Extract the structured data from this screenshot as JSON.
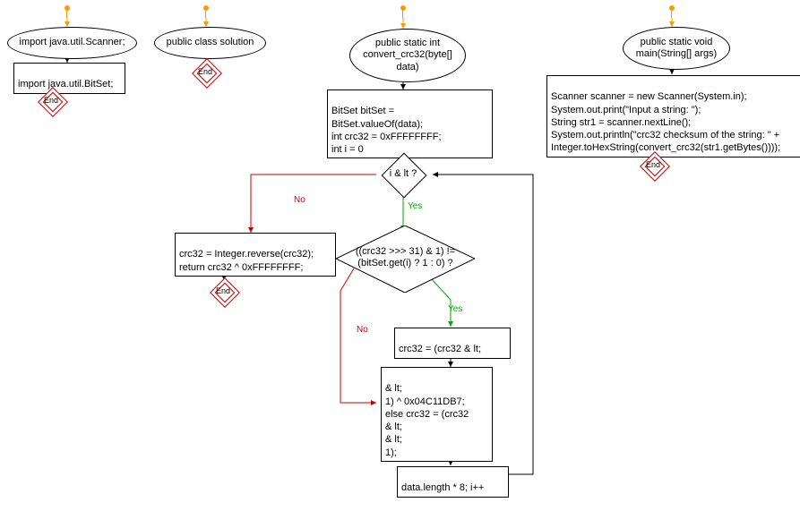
{
  "start_arrow_color": "#f90",
  "nodes": {
    "import1": {
      "text": "import java.util.Scanner;"
    },
    "import2": {
      "text": "import java.util.BitSet;"
    },
    "class_decl": {
      "text": "public class solution"
    },
    "method_convert": {
      "text": "public static int\nconvert_crc32(byte[]\ndata)"
    },
    "init_block": {
      "text": "BitSet bitSet = BitSet.valueOf(data);\nint crc32 = 0xFFFFFFFF;\nint i = 0"
    },
    "cond_i": {
      "text": "i & lt ?"
    },
    "cond_bit": {
      "text": "((crc32 >>> 31) & 1) !=\n(bitSet.get(i) ? 1 : 0) ?"
    },
    "no_branch": {
      "text": "crc32 = Integer.reverse(crc32);\nreturn crc32 ^ 0xFFFFFFFF;"
    },
    "yes_assign": {
      "text": "crc32 = (crc32 & lt;"
    },
    "else_block": {
      "text": "& lt;\n1) ^ 0x04C11DB7;\nelse crc32 = (crc32\n& lt;\n& lt;\n1);"
    },
    "loop_inc": {
      "text": "data.length * 8; i++"
    },
    "method_main": {
      "text": "public static void\nmain(String[] args)"
    },
    "main_body": {
      "text": "Scanner scanner = new Scanner(System.in);\nSystem.out.print(\"Input a string: \");\nString str1 = scanner.nextLine();\nSystem.out.println(\"crc32 checksum of the string: \" +\nInteger.toHexString(convert_crc32(str1.getBytes())));"
    },
    "end": {
      "text": "End"
    }
  },
  "labels": {
    "yes": "Yes",
    "no": "No"
  }
}
